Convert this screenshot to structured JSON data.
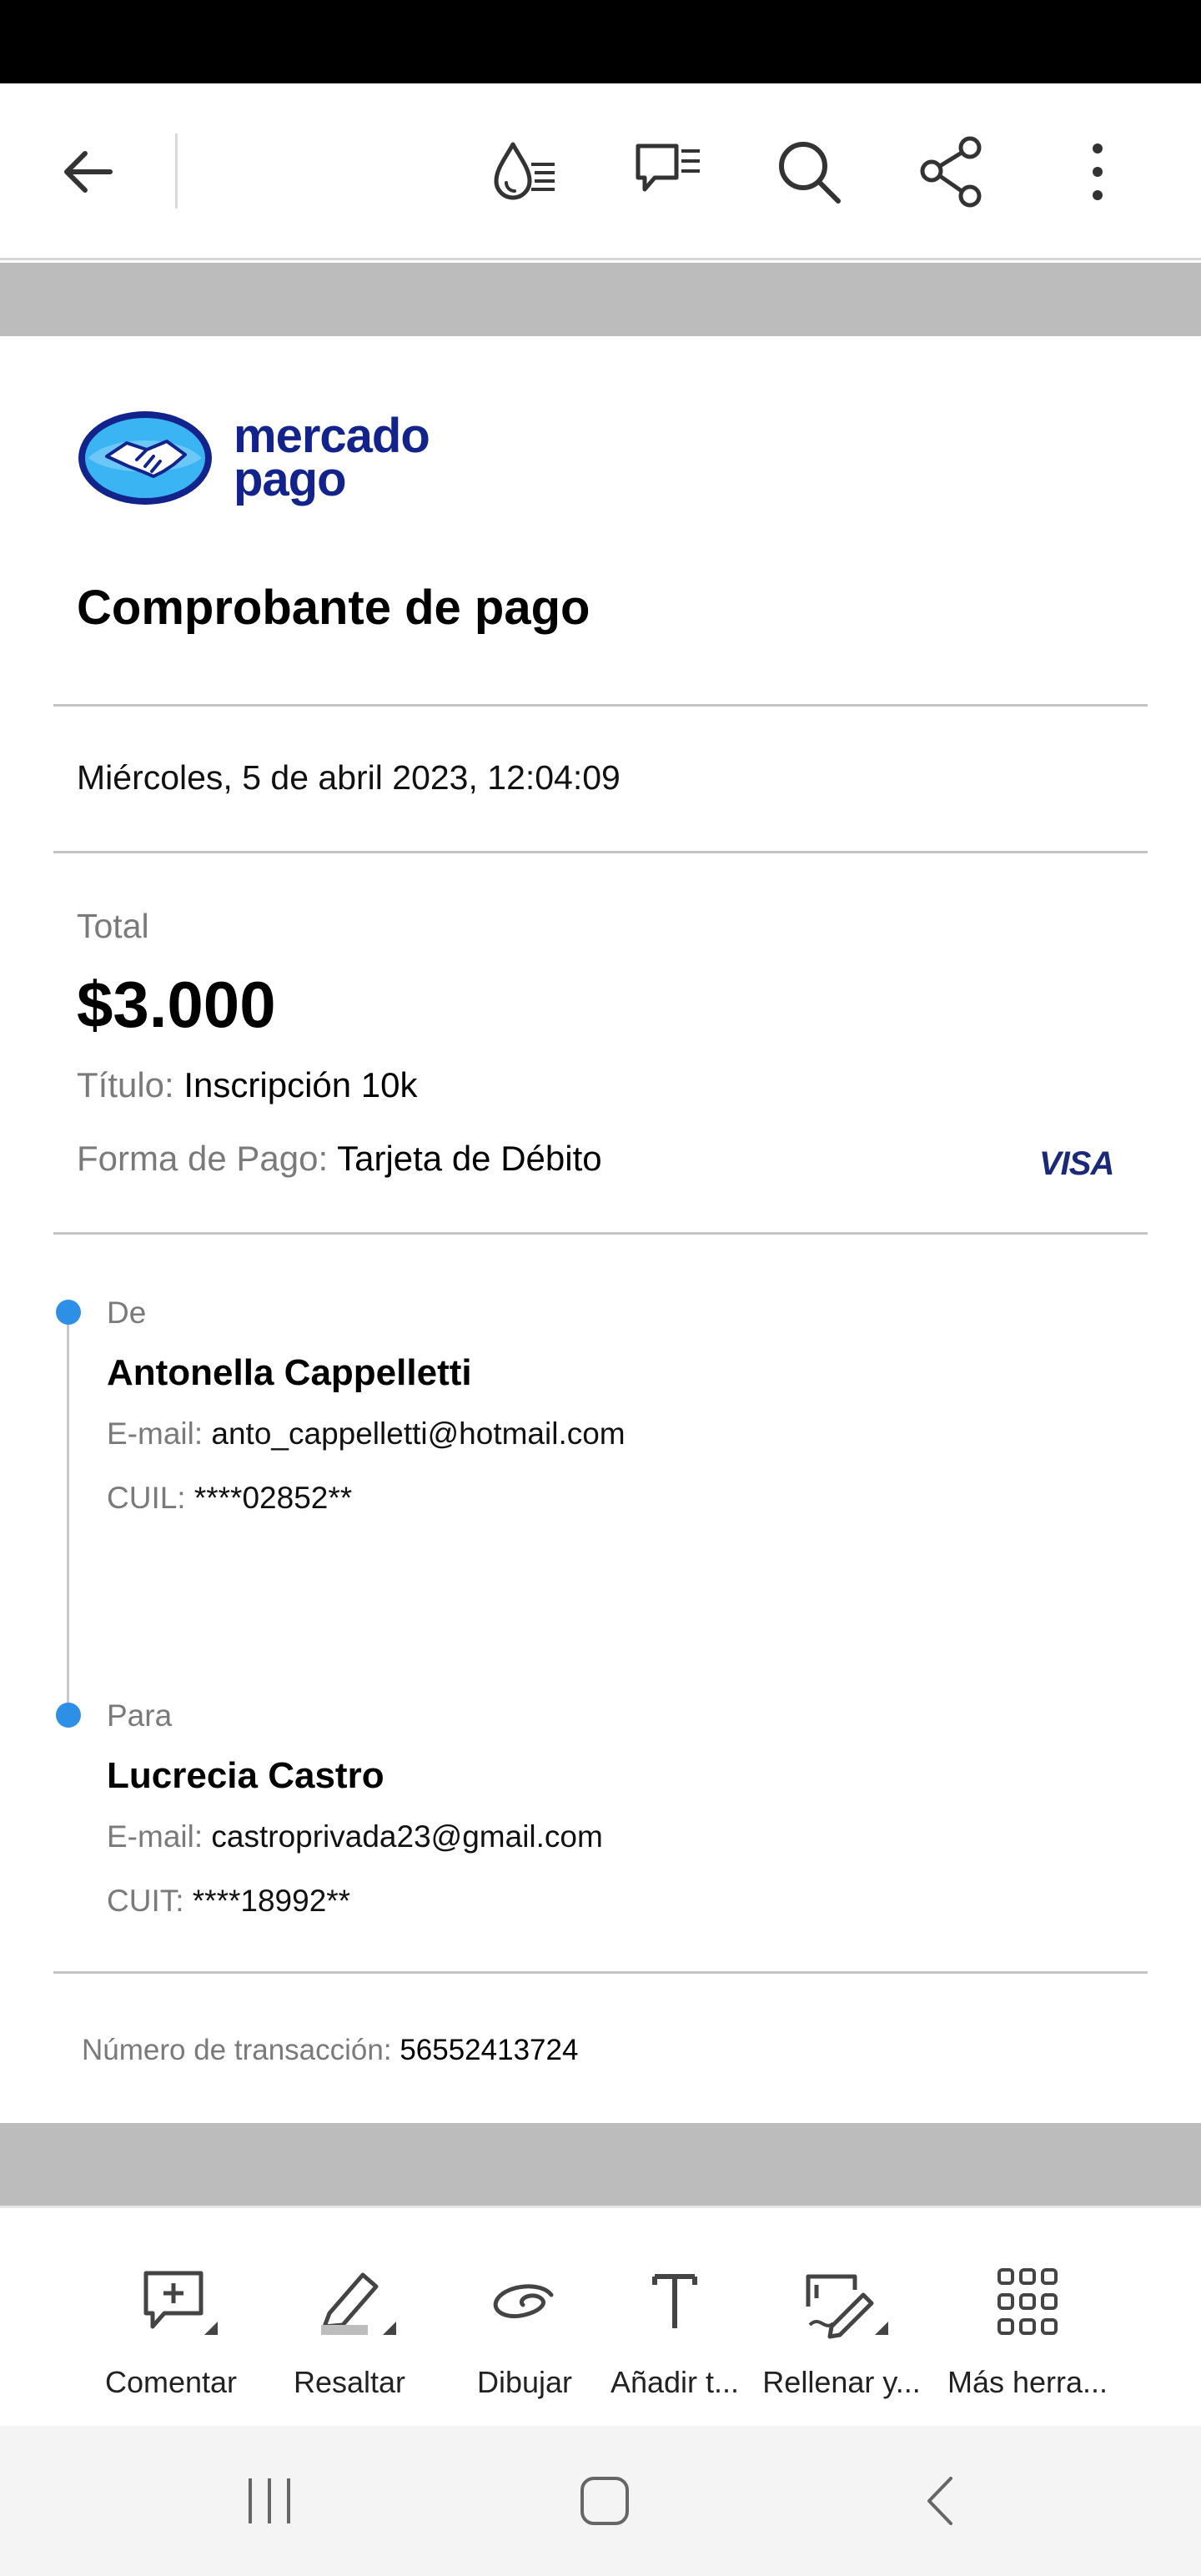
{
  "colors": {
    "brand_blue": "#12238b",
    "accent_dot": "#2d8fe6",
    "gray_band": "#bcbcbc",
    "divider": "#c4c4c4",
    "visa_blue": "#1a2a78"
  },
  "toolbar": {
    "icons": [
      "back-arrow-icon",
      "drop-list-icon",
      "comments-icon",
      "search-icon",
      "share-icon",
      "more-vertical-icon"
    ]
  },
  "receipt": {
    "logo_line1": "mercado",
    "logo_line2": "pago",
    "title": "Comprobante de pago",
    "datetime": "Miércoles, 5 de abril 2023, 12:04:09",
    "total_label": "Total",
    "total_value": "$3.000",
    "titulo_label": "Título:",
    "titulo_value": "Inscripción 10k",
    "forma_label": "Forma de Pago:",
    "forma_value": "Tarjeta de Débito",
    "card_brand": "VISA",
    "from": {
      "label": "De",
      "name": "Antonella Cappelletti",
      "email_label": "E-mail:",
      "email": "anto_cappelletti@hotmail.com",
      "id_label": "CUIL:",
      "id_value": "****02852**"
    },
    "to": {
      "label": "Para",
      "name": "Lucrecia Castro",
      "email_label": "E-mail:",
      "email": "castroprivada23@gmail.com",
      "id_label": "CUIT:",
      "id_value": "****18992**"
    },
    "txn_label": "Número de transacción:",
    "txn_value": "56552413724"
  },
  "tools": [
    {
      "label": "Comentar",
      "icon": "comment-add-icon"
    },
    {
      "label": "Resaltar",
      "icon": "highlighter-icon"
    },
    {
      "label": "Dibujar",
      "icon": "draw-icon"
    },
    {
      "label": "Añadir t...",
      "icon": "text-icon"
    },
    {
      "label": "Rellenar y...",
      "icon": "fill-sign-icon"
    },
    {
      "label": "Más herra...",
      "icon": "grid-icon"
    }
  ],
  "nav": {
    "icons": [
      "recents-icon",
      "home-icon",
      "back-icon"
    ]
  }
}
